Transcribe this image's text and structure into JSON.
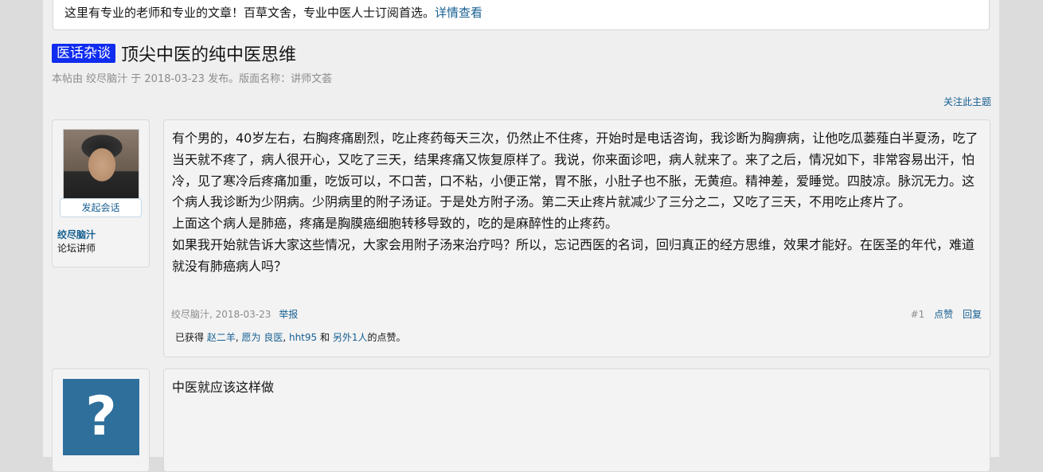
{
  "notice": {
    "text": "这里有专业的老师和专业的文章！百草文舍，专业中医人士订阅首选。",
    "link": "详情查看"
  },
  "thread": {
    "prefix": "医话杂谈",
    "title": "顶尖中医的纯中医思维",
    "byline": "本帖由 绞尽脑汁 于 2018-03-23 发布。版面名称：讲师文荟",
    "follow_label": "关注此主题"
  },
  "posts": [
    {
      "conversation_label": "发起会话",
      "username": "绞尽脑汁",
      "user_title": "论坛讲师",
      "paragraphs": [
        "有个男的，40岁左右，右胸疼痛剧烈，吃止疼药每天三次，仍然止不住疼，开始时是电话咨询，我诊断为胸痹病，让他吃瓜蒌薤白半夏汤，吃了当天就不疼了，病人很开心，又吃了三天，结果疼痛又恢复原样了。我说，你来面诊吧，病人就来了。来了之后，情况如下，非常容易出汗，怕冷，见了寒冷后疼痛加重，吃饭可以，不口苦，口不粘，小便正常，胃不胀，小肚子也不胀，无黄疸。精神差，爱睡觉。四肢凉。脉沉无力。这个病人我诊断为少阴病。少阴病里的附子汤证。于是处方附子汤。第二天止疼片就减少了三分之二，又吃了三天，不用吃止疼片了。",
        "上面这个病人是肺癌，疼痛是胸膜癌细胞转移导致的，吃的是麻醉性的止疼药。",
        "如果我开始就告诉大家这些情况，大家会用附子汤来治疗吗？所以，忘记西医的名词，回归真正的经方思维，效果才能好。在医圣的年代，难道就没有肺癌病人吗？"
      ],
      "meta_author_date": "绞尽脑汁, 2018-03-23",
      "report_label": "举报",
      "post_number": "#1",
      "like_label": "点赞",
      "reply_label": "回复",
      "likes": {
        "prefix": "已获得",
        "users": [
          "赵二羊",
          "愿为 良医",
          "hht95"
        ],
        "and": "和",
        "others": "另外1人",
        "suffix": "的点赞。"
      }
    },
    {
      "avatar_glyph": "?",
      "paragraphs": [
        "中医就应该这样做"
      ]
    }
  ]
}
